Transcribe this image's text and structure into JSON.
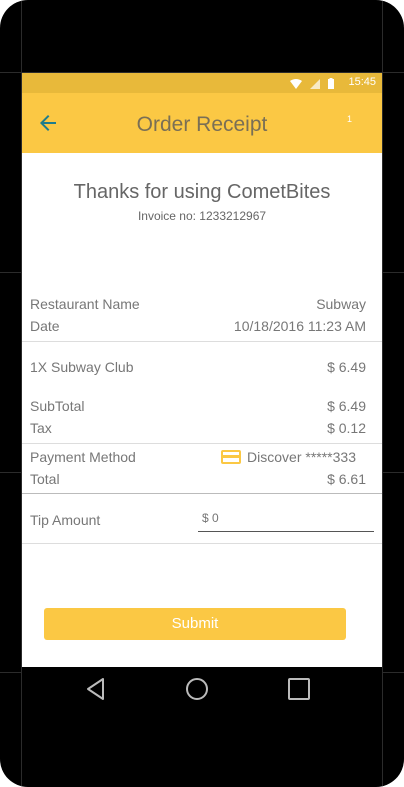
{
  "status_bar": {
    "time": "15:45"
  },
  "app_bar": {
    "title": "Order Receipt",
    "badge": "1"
  },
  "header": {
    "thanks": "Thanks for using CometBites",
    "invoice": "Invoice no: 1233212967"
  },
  "receipt": {
    "restaurant_label": "Restaurant Name",
    "restaurant_value": "Subway",
    "date_label": "Date",
    "date_value": "10/18/2016 11:23 AM",
    "item_label": "1X Subway Club",
    "item_value": "$ 6.49",
    "subtotal_label": "SubTotal",
    "subtotal_value": "$ 6.49",
    "tax_label": "Tax",
    "tax_value": "$ 0.12",
    "payment_label": "Payment Method",
    "payment_value": "Discover *****333",
    "total_label": "Total",
    "total_value": "$ 6.61"
  },
  "tip": {
    "label": "Tip Amount",
    "placeholder": "$ 0"
  },
  "submit_label": "Submit",
  "colors": {
    "primary": "#FBC844",
    "status_bar": "#E8B93A",
    "back_icon": "#1E7D8C"
  },
  "icons": [
    "back-arrow-icon",
    "wifi-icon",
    "signal-icon",
    "battery-icon",
    "credit-card-icon",
    "nav-back-icon",
    "nav-home-icon",
    "nav-recents-icon"
  ]
}
